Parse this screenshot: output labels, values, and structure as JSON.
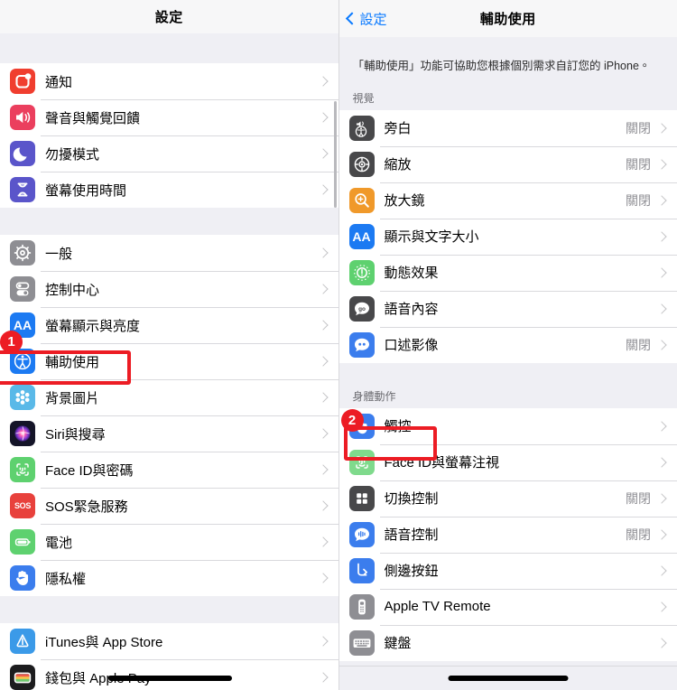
{
  "left_panel": {
    "nav": {
      "title": "設定"
    },
    "groups": [
      {
        "rows": [
          {
            "label": "通知",
            "icon": "notifications-icon",
            "value": ""
          },
          {
            "label": "聲音與觸覺回饋",
            "icon": "sounds-haptics-icon",
            "value": ""
          },
          {
            "label": "勿擾模式",
            "icon": "do-not-disturb-icon",
            "value": ""
          },
          {
            "label": "螢幕使用時間",
            "icon": "screen-time-icon",
            "value": ""
          }
        ]
      },
      {
        "rows": [
          {
            "label": "一般",
            "icon": "general-gear-icon",
            "value": ""
          },
          {
            "label": "控制中心",
            "icon": "control-center-icon",
            "value": ""
          },
          {
            "label": "螢幕顯示與亮度",
            "icon": "display-brightness-icon",
            "value": ""
          },
          {
            "label": "輔助使用",
            "icon": "accessibility-icon",
            "value": ""
          },
          {
            "label": "背景圖片",
            "icon": "wallpaper-icon",
            "value": ""
          },
          {
            "label": "Siri與搜尋",
            "icon": "siri-search-icon",
            "value": ""
          },
          {
            "label": "Face ID與密碼",
            "icon": "face-id-icon",
            "value": ""
          },
          {
            "label": "SOS緊急服務",
            "icon": "emergency-sos-icon",
            "value": ""
          },
          {
            "label": "電池",
            "icon": "battery-icon",
            "value": ""
          },
          {
            "label": "隱私權",
            "icon": "privacy-hand-icon",
            "value": ""
          }
        ]
      },
      {
        "rows": [
          {
            "label": "iTunes與 App Store",
            "icon": "app-store-icon",
            "value": ""
          },
          {
            "label": "錢包與 Apple Pay",
            "icon": "wallet-icon",
            "value": ""
          }
        ]
      }
    ]
  },
  "right_panel": {
    "nav": {
      "back_label": "設定",
      "title": "輔助使用",
      "back_icon": "chevron-left-icon"
    },
    "blurb": "「輔助使用」功能可協助您根據個別需求自訂您的 iPhone。",
    "sections": [
      {
        "header": "視覺",
        "rows": [
          {
            "label": "旁白",
            "icon": "voiceover-icon",
            "value": "關閉"
          },
          {
            "label": "縮放",
            "icon": "zoom-icon",
            "value": "關閉"
          },
          {
            "label": "放大鏡",
            "icon": "magnifier-icon",
            "value": "關閉"
          },
          {
            "label": "顯示與文字大小",
            "icon": "display-text-size-icon",
            "value": ""
          },
          {
            "label": "動態效果",
            "icon": "motion-icon",
            "value": ""
          },
          {
            "label": "語音內容",
            "icon": "spoken-content-icon",
            "value": ""
          },
          {
            "label": "口述影像",
            "icon": "audio-descriptions-icon",
            "value": "關閉"
          }
        ]
      },
      {
        "header": "身體動作",
        "rows": [
          {
            "label": "觸控",
            "icon": "touch-icon",
            "value": ""
          },
          {
            "label": "Face ID與螢幕注視",
            "icon": "face-id-attention-icon",
            "value": ""
          },
          {
            "label": "切換控制",
            "icon": "switch-control-icon",
            "value": "關閉"
          },
          {
            "label": "語音控制",
            "icon": "voice-control-icon",
            "value": "關閉"
          },
          {
            "label": "側邊按鈕",
            "icon": "side-button-icon",
            "value": ""
          },
          {
            "label": "Apple TV Remote",
            "icon": "apple-tv-remote-icon",
            "value": ""
          },
          {
            "label": "鍵盤",
            "icon": "keyboard-icon",
            "value": ""
          }
        ]
      }
    ]
  },
  "annotations": {
    "step1": {
      "number": "1",
      "target": "輔助使用",
      "color": "#ec1c24"
    },
    "step2": {
      "number": "2",
      "target": "觸控",
      "color": "#ec1c24"
    }
  }
}
